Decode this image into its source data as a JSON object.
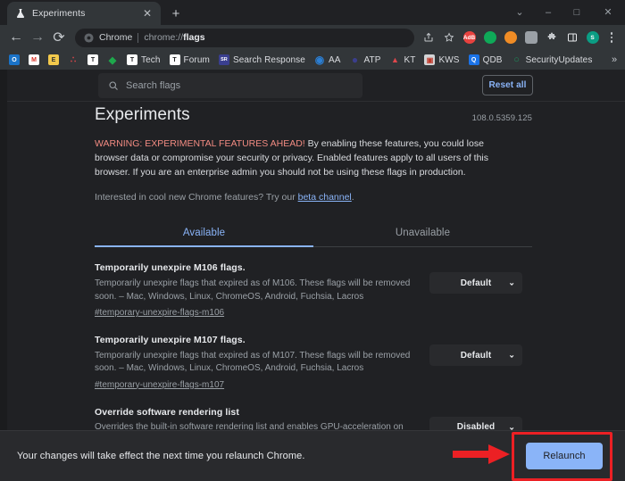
{
  "window": {
    "controls": [
      {
        "name": "tab-search",
        "glyph": "⌄"
      },
      {
        "name": "minimize",
        "glyph": "–"
      },
      {
        "name": "maximize",
        "glyph": "□"
      },
      {
        "name": "close",
        "glyph": "✕"
      }
    ]
  },
  "tabstrip": {
    "tab_title": "Experiments",
    "tab_favicon": "flask-icon",
    "close_glyph": "✕",
    "new_tab_glyph": "+"
  },
  "toolbar": {
    "back_glyph": "←",
    "forward_glyph": "→",
    "reload_glyph": "⟳",
    "omnibox": {
      "site_chip": "Chrome",
      "url_prefix": "chrome://",
      "url_bold": "flags"
    },
    "share_glyph": "⇪",
    "bookmark_glyph": "☆",
    "extensions": [
      {
        "name": "ext-aap",
        "label": "AdB",
        "color": "#e8423f"
      },
      {
        "name": "ext-green",
        "label": "",
        "color": "#0fa958"
      },
      {
        "name": "ext-orange",
        "label": "",
        "color": "#f08c25"
      },
      {
        "name": "ext-camera",
        "label": "",
        "color": "#9aa0a6"
      },
      {
        "name": "ext-puzzle",
        "label": "",
        "color": "#c4c8cc"
      },
      {
        "name": "ext-sidepanel",
        "label": "",
        "color": "#e8eaed"
      },
      {
        "name": "ext-profile",
        "label": "S",
        "color": "#0b9d84"
      }
    ]
  },
  "bookmarks": {
    "items": [
      {
        "label": "",
        "icon_text": "O",
        "color": "#1a73c8"
      },
      {
        "label": "",
        "icon_text": "M",
        "color": "#ffffff"
      },
      {
        "label": "",
        "icon_text": "E",
        "color": "#f2c94c"
      },
      {
        "label": "",
        "icon_text": "∴",
        "color": "#e0474c"
      },
      {
        "label": "",
        "icon_text": "T",
        "color": "#ffffff"
      },
      {
        "label": "",
        "icon_text": "◆",
        "color": "#1ea84c"
      },
      {
        "label": "Tech",
        "icon_text": "T",
        "color": "#ffffff"
      },
      {
        "label": "Forum",
        "icon_text": "T",
        "color": "#ffffff"
      },
      {
        "label": "Search Response",
        "icon_text": "SR",
        "color": "#3a3f8f"
      },
      {
        "label": "AA",
        "icon_text": "◉",
        "color": "#2b7fd4"
      },
      {
        "label": "ATP",
        "icon_text": "●",
        "color": "#3b3e8c"
      },
      {
        "label": "KT",
        "icon_text": "▲",
        "color": "#e0474c"
      },
      {
        "label": "KWS",
        "icon_text": "▣",
        "color": "#d2d4d6"
      },
      {
        "label": "QDB",
        "icon_text": "Q",
        "color": "#1a73e8"
      },
      {
        "label": "SecurityUpdates",
        "icon_text": "○",
        "color": "#1e8e5a"
      }
    ],
    "overflow_glyph": "»"
  },
  "flags_page": {
    "search": {
      "placeholder": "Search flags",
      "value": "",
      "icon": "search-icon"
    },
    "reset_all_label": "Reset all",
    "title": "Experiments",
    "version": "108.0.5359.125",
    "warning_strong": "WARNING: EXPERIMENTAL FEATURES AHEAD!",
    "warning_rest": " By enabling these features, you could lose browser data or compromise your security or privacy. Enabled features apply to all users of this browser. If you are an enterprise admin you should not be using these flags in production.",
    "beta_prefix": "Interested in cool new Chrome features? Try our ",
    "beta_link": "beta channel",
    "beta_suffix": ".",
    "tabs": [
      {
        "label": "Available",
        "active": true
      },
      {
        "label": "Unavailable",
        "active": false
      }
    ],
    "flags": [
      {
        "name": "Temporarily unexpire M106 flags.",
        "description": "Temporarily unexpire flags that expired as of M106. These flags will be removed soon. – Mac, Windows, Linux, ChromeOS, Android, Fuchsia, Lacros",
        "link": "#temporary-unexpire-flags-m106",
        "select_value": "Default",
        "chevron": "⌄"
      },
      {
        "name": "Temporarily unexpire M107 flags.",
        "description": "Temporarily unexpire flags that expired as of M107. These flags will be removed soon. – Mac, Windows, Linux, ChromeOS, Android, Fuchsia, Lacros",
        "link": "#temporary-unexpire-flags-m107",
        "select_value": "Default",
        "chevron": "⌄"
      },
      {
        "name": "Override software rendering list",
        "description": "Overrides the built-in software rendering list and enables GPU-acceleration on unsupported system configurations. – Mac, Windows, Linux, ChromeOS, Android, Fuchsia, Lacros",
        "link": "",
        "select_value": "Disabled",
        "chevron": "⌄"
      }
    ]
  },
  "relaunch_bar": {
    "message": "Your changes will take effect the next time you relaunch Chrome.",
    "button_label": "Relaunch"
  },
  "annotations": {
    "highlight_color": "#ec2024",
    "arrow": "red-arrow-pointing-right",
    "box": "red-highlight-box-around-relaunch-button"
  }
}
